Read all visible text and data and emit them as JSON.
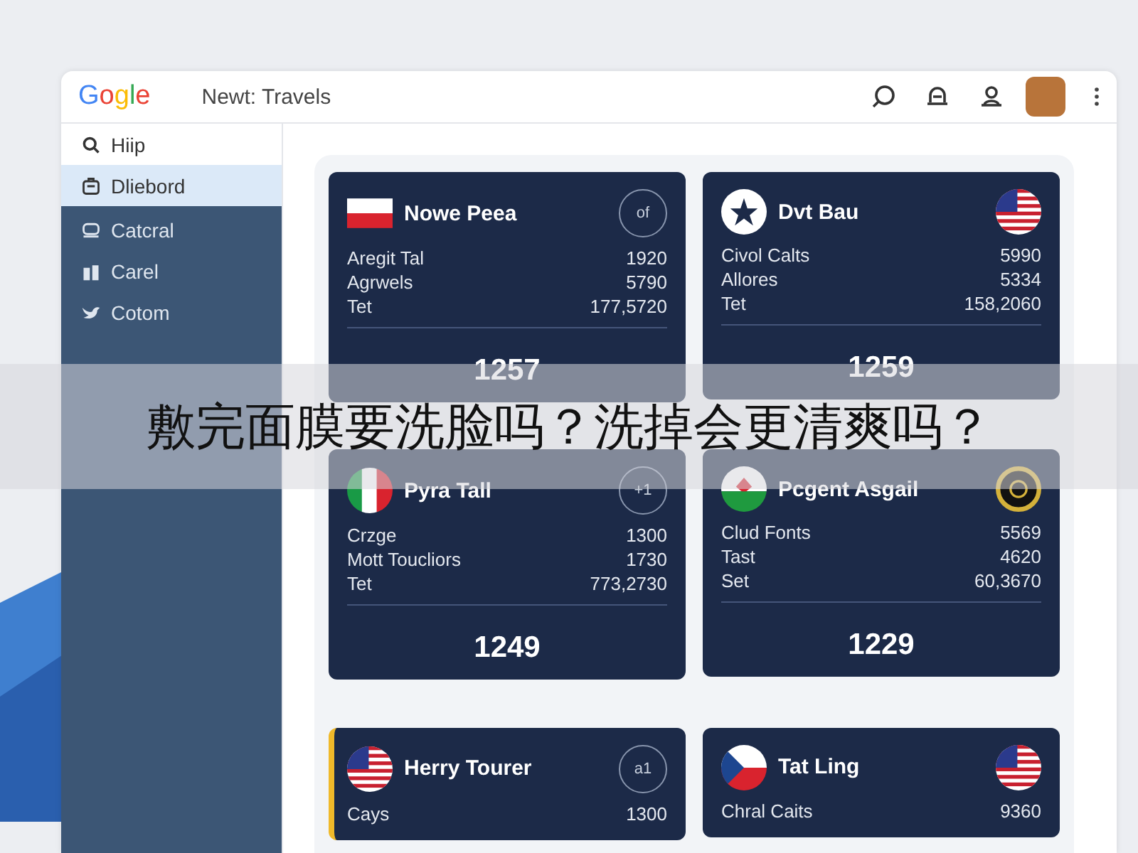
{
  "header": {
    "logo": "Gogle",
    "title": "Newt: Travels"
  },
  "sidebar": {
    "items": [
      {
        "label": "Hiip",
        "selected": false
      },
      {
        "label": "Dliebord",
        "selected": true
      }
    ],
    "panel_items": [
      {
        "label": "Catcral",
        "selected": false
      },
      {
        "label": "Carel",
        "selected": false
      },
      {
        "label": "Cotom",
        "selected": false
      }
    ]
  },
  "cards": [
    {
      "title": "Nowe Peea",
      "right": {
        "kind": "badge",
        "text": "of"
      },
      "selected": false,
      "rows": [
        [
          "Aregit Tal",
          "1920"
        ],
        [
          "Agrwels",
          "5790"
        ],
        [
          "Tet",
          "177,5720"
        ]
      ],
      "total": "1257"
    },
    {
      "title": "Dvt Bau",
      "right": {
        "kind": "flag"
      },
      "selected": false,
      "rows": [
        [
          "Civol Calts",
          "5990"
        ],
        [
          "Allores",
          "5334"
        ],
        [
          "Tet",
          "158,2060"
        ]
      ],
      "total": "1259"
    },
    {
      "title": "Pyra Tall",
      "right": {
        "kind": "badge",
        "text": "+1"
      },
      "selected": false,
      "rows": [
        [
          "Crzge",
          "1300"
        ],
        [
          "Mott Toucliors",
          "1730"
        ],
        [
          "Tet",
          "773,2730"
        ]
      ],
      "total": "1249"
    },
    {
      "title": "Pcgent Asgail",
      "right": {
        "kind": "flag"
      },
      "selected": false,
      "rows": [
        [
          "Clud Fonts",
          "5569"
        ],
        [
          "Tast",
          "4620"
        ],
        [
          "Set",
          "60,3670"
        ]
      ],
      "total": "1229"
    },
    {
      "title": "Herry Tourer",
      "right": {
        "kind": "badge",
        "text": "a1"
      },
      "selected": true,
      "rows": [
        [
          "Cays",
          "1300"
        ]
      ]
    },
    {
      "title": "Tat Ling",
      "right": {
        "kind": "flag"
      },
      "selected": false,
      "rows": [
        [
          "Chral Caits",
          "9360"
        ]
      ]
    }
  ],
  "banner": {
    "text": "敷完面膜要洗脸吗？洗掉会更清爽吗？"
  }
}
